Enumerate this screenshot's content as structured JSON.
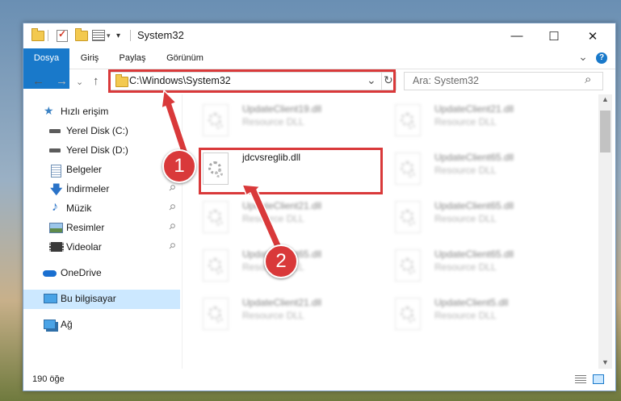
{
  "window": {
    "title": "System32",
    "controls": {
      "minimize": "—",
      "maximize": "☐",
      "close": "✕"
    }
  },
  "ribbon": {
    "tabs": [
      "Dosya",
      "Giriş",
      "Paylaş",
      "Görünüm"
    ],
    "expand_glyph": "⌄",
    "help_glyph": "?"
  },
  "navigation": {
    "back": "←",
    "forward": "→",
    "recent": "⌄",
    "up": "↑",
    "address": "C:\\Windows\\System32",
    "address_dropdown": "⌄",
    "refresh": "↻",
    "search_placeholder": "Ara: System32",
    "search_icon": "⌕"
  },
  "sidebar": {
    "items": [
      {
        "label": "Hızlı erişim",
        "icon": "star-icon",
        "glyph": "★"
      },
      {
        "label": "Yerel Disk (C:)",
        "icon": "drive-icon"
      },
      {
        "label": "Yerel Disk (D:)",
        "icon": "drive-icon"
      },
      {
        "label": "Belgeler",
        "icon": "documents-icon",
        "pinned": true
      },
      {
        "label": "İndirmeler",
        "icon": "download-icon",
        "glyph": "🡇",
        "pinned": true
      },
      {
        "label": "Müzik",
        "icon": "music-icon",
        "glyph": "♪",
        "pinned": true
      },
      {
        "label": "Resimler",
        "icon": "pictures-icon",
        "pinned": true
      },
      {
        "label": "Videolar",
        "icon": "video-icon",
        "pinned": true
      },
      {
        "label": "OneDrive",
        "icon": "cloud-icon"
      },
      {
        "label": "Bu bilgisayar",
        "icon": "computer-icon",
        "selected": true
      },
      {
        "label": "Ağ",
        "icon": "network-icon"
      }
    ],
    "pin_glyph": "📌"
  },
  "files": [
    {
      "name": "UpdateClient19.dll",
      "type": "Resource DLL"
    },
    {
      "name": "UpdateClient21.dll",
      "type": "Resource DLL"
    },
    {
      "name": "jdcvsreglib.dll",
      "type": ""
    },
    {
      "name": "UpdateClient65.dll",
      "type": "Resource DLL"
    },
    {
      "name": "UpdateClient21.dll",
      "type": "Resource DLL"
    },
    {
      "name": "UpdateClient65.dll",
      "type": "Resource DLL"
    },
    {
      "name": "UpdateClient65.dll",
      "type": "Resource DLL"
    },
    {
      "name": "UpdateClient65.dll",
      "type": "Resource DLL"
    },
    {
      "name": "UpdateClient21.dll",
      "type": "Resource DLL"
    },
    {
      "name": "UpdateClient5.dll",
      "type": "Resource DLL"
    }
  ],
  "status": {
    "count": "190 öğe"
  },
  "annotations": {
    "step1": "1",
    "step2": "2",
    "accent": "#d9393a"
  },
  "colors": {
    "file_tab": "#1979ca",
    "selected_nav": "#cce8ff"
  }
}
